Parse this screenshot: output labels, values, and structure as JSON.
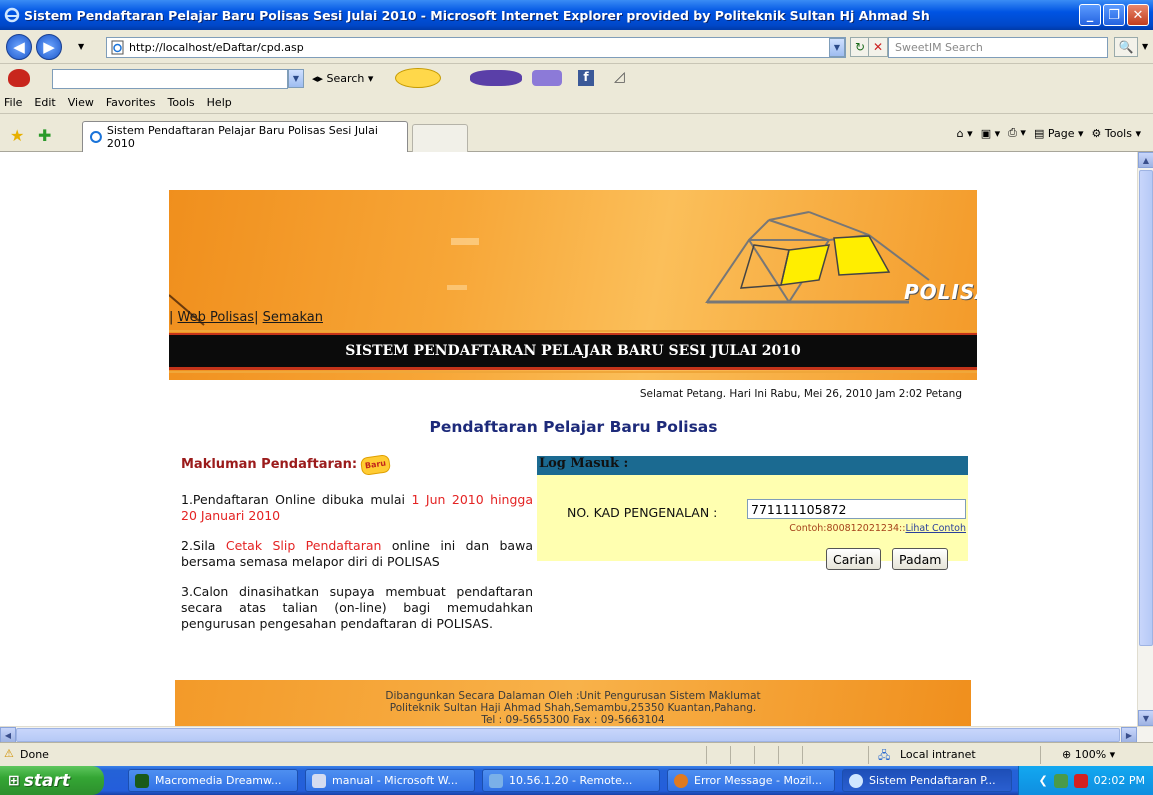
{
  "window": {
    "title": "Sistem Pendaftaran Pelajar Baru Polisas Sesi Julai 2010 - Microsoft Internet Explorer provided by Politeknik Sultan Hj Ahmad Sh"
  },
  "address": {
    "url": "http://localhost/eDaftar/cpd.asp",
    "search_placeholder": "SweetIM Search"
  },
  "toolbar": {
    "search_label": "Search"
  },
  "menu": [
    "File",
    "Edit",
    "View",
    "Favorites",
    "Tools",
    "Help"
  ],
  "tab": {
    "label": "Sistem Pendaftaran Pelajar Baru Polisas Sesi Julai 2010"
  },
  "commandbar": {
    "page": "Page",
    "tools": "Tools"
  },
  "page": {
    "nav_link_1": "Web Polisas",
    "nav_link_2": "Semakan",
    "logo_text": "POLISAS",
    "banner_title": "SISTEM PENDAFTARAN PELAJAR BARU SESI JULAI 2010",
    "greeting": "Selamat Petang. Hari Ini Rabu, Mei 26, 2010 Jam 2:02 Petang",
    "heading": "Pendaftaran Pelajar Baru Polisas",
    "info_heading": "Makluman Pendaftaran:",
    "new_badge": "Baru",
    "item1_text": "1.Pendaftaran Online dibuka mulai",
    "item1_highlight": "1 Jun 2010 hingga 20 Januari 2010",
    "item2_prefix": "2.Sila",
    "item2_highlight": "Cetak Slip Pendaftaran",
    "item2_suffix": "online ini dan bawa bersama semasa melapor diri di POLISAS",
    "item3": "3.Calon dinasihatkan supaya membuat pendaftaran secara atas talian (on-line) bagi memudahkan pengurusan pengesahan pendaftaran di POLISAS.",
    "login_heading": "Log Masuk :",
    "ic_label": "NO. KAD PENGENALAN :",
    "ic_value": "771111105872",
    "hint_text": "Contoh:800812021234::",
    "hint_link": "Lihat Contoh",
    "search_button": "Carian",
    "clear_button": "Padam",
    "footer_line1": "Dibangunkan Secara Dalaman Oleh :Unit Pengurusan Sistem Maklumat",
    "footer_line2": "Politeknik Sultan Haji Ahmad Shah,Semambu,25350 Kuantan,Pahang.",
    "footer_line3": "Tel : 09-5655300  Fax : 09-5663104"
  },
  "statusbar": {
    "status": "Done",
    "zone": "Local intranet",
    "zoom": "100%"
  },
  "taskbar": {
    "start": "start",
    "tasks": [
      "Macromedia Dreamw...",
      "manual - Microsoft W...",
      "10.56.1.20 - Remote...",
      "Error Message - Mozil...",
      "Sistem Pendaftaran P..."
    ],
    "clock": "02:02 PM"
  },
  "colors": {
    "accent": "#0054e3",
    "banner": "#f7a637",
    "login_head": "#1b6a91",
    "login_body": "#ffffb0",
    "heading": "#1d2a7a",
    "highlight": "#e42323"
  }
}
